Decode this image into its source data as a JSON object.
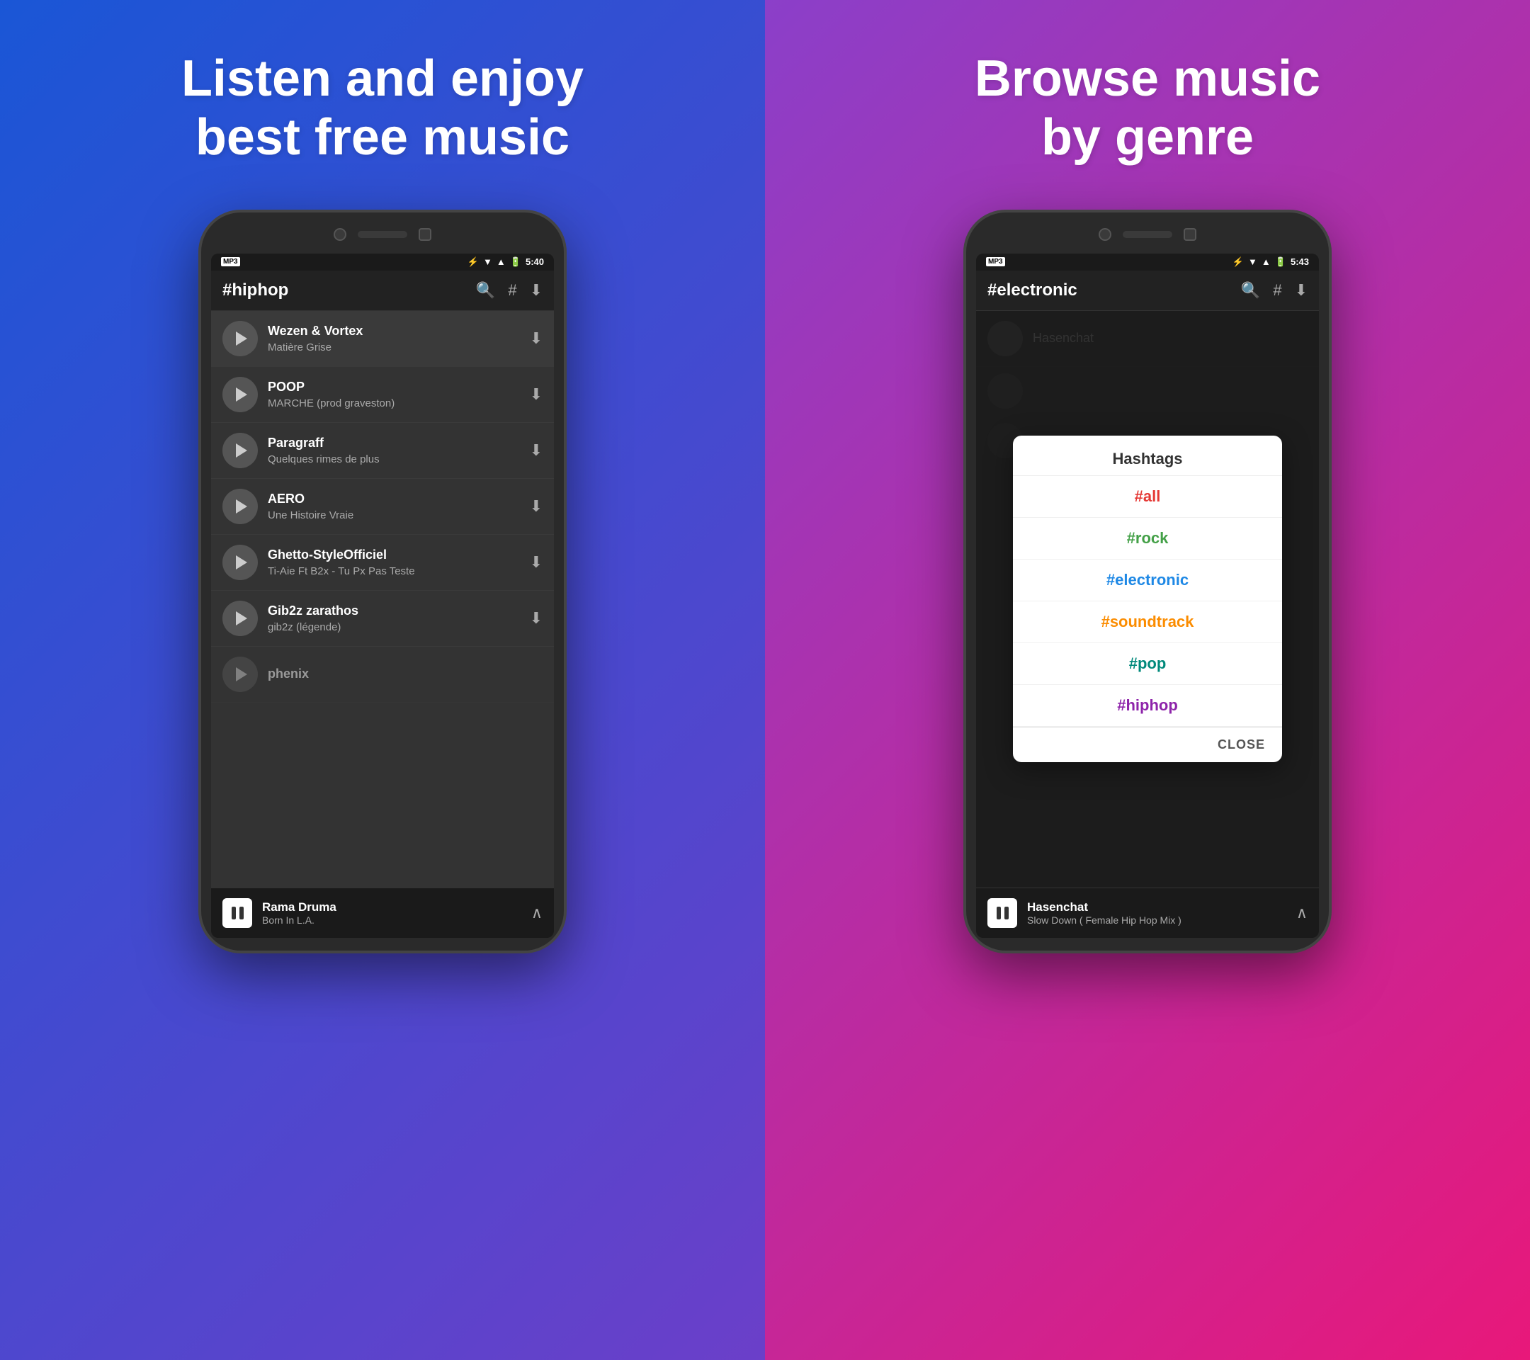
{
  "left": {
    "headline_line1": "Listen and enjoy",
    "headline_line2": "best free music",
    "phone": {
      "status_time": "5:40",
      "app_title": "#hiphop",
      "header_icons": [
        "search",
        "hashtag",
        "download"
      ],
      "tracks": [
        {
          "name": "Wezen & Vortex",
          "artist": "Matière Grise"
        },
        {
          "name": "POOP",
          "artist": "MARCHE (prod graveston)"
        },
        {
          "name": "Paragraff",
          "artist": "Quelques rimes de plus"
        },
        {
          "name": "AERO",
          "artist": "Une Histoire Vraie"
        },
        {
          "name": "Ghetto-StyleOfficiel",
          "artist": "Ti-Aie Ft B2x - Tu Px Pas Teste"
        },
        {
          "name": "Gib2z zarathos",
          "artist": "gib2z (légende)"
        },
        {
          "name": "phenix",
          "artist": ""
        }
      ],
      "now_playing_name": "Rama Druma",
      "now_playing_sub": "Born In L.A."
    }
  },
  "right": {
    "headline_line1": "Browse music",
    "headline_line2": "by genre",
    "phone": {
      "status_time": "5:43",
      "app_title": "#electronic",
      "header_icons": [
        "search",
        "hashtag",
        "download"
      ],
      "dialog": {
        "title": "Hashtags",
        "items": [
          {
            "label": "#all",
            "color": "#e53935"
          },
          {
            "label": "#rock",
            "color": "#43a047"
          },
          {
            "label": "#electronic",
            "color": "#1e88e5"
          },
          {
            "label": "#soundtrack",
            "color": "#fb8c00"
          },
          {
            "label": "#pop",
            "color": "#00897b"
          },
          {
            "label": "#hiphop",
            "color": "#8e24aa"
          }
        ],
        "close_label": "CLOSE"
      },
      "now_playing_name": "Hasenchat",
      "now_playing_sub": "Slow Down ( Female Hip Hop Mix )"
    }
  }
}
